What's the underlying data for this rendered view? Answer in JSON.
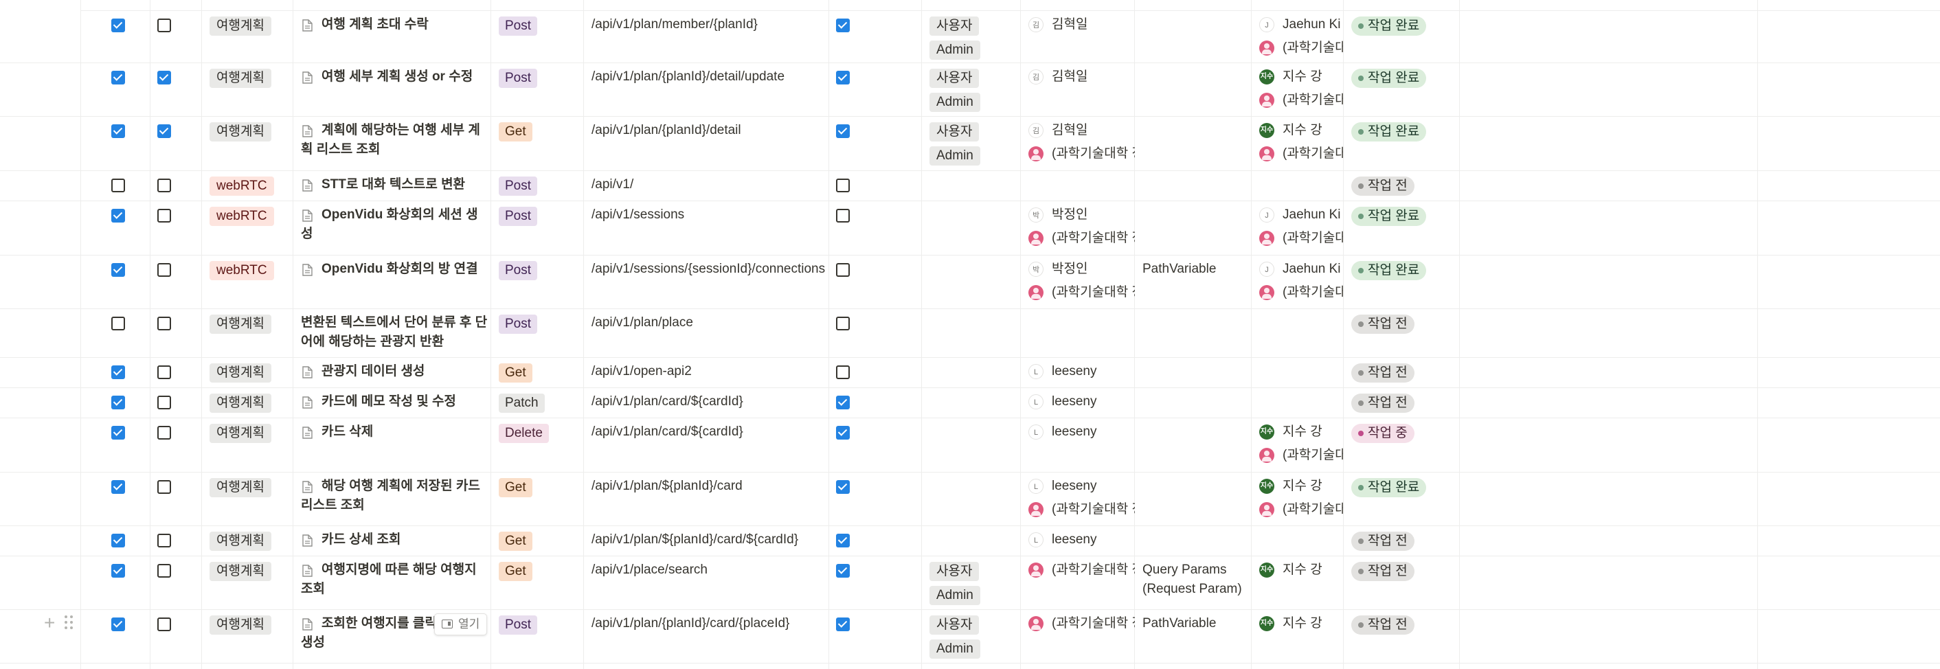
{
  "columns": {
    "tag_options": {
      "travel": "여행계획",
      "webrtc": "webRTC"
    },
    "permission_options": [
      "사용자",
      "Admin"
    ]
  },
  "hover_controls": {
    "add_icon": "plus-icon",
    "drag_icon": "drag-handle-icon",
    "open_label": "열기"
  },
  "rows": [
    {
      "done": true,
      "front": false,
      "tag": "여행계획",
      "tag_style": "travel",
      "has_icon": true,
      "title": "여행 계획 초대 수락",
      "method": "Post",
      "url": "/api/v1/plan/member/{planId}",
      "api_done": true,
      "perms": [
        "사용자",
        "Admin"
      ],
      "backend": [
        {
          "avatar": "init",
          "initial": "김",
          "name": "김혁일"
        }
      ],
      "note": "",
      "frontend": [
        {
          "avatar": "init",
          "initial": "J",
          "name": "Jaehun Ki"
        },
        {
          "avatar": "pink",
          "initial": "",
          "name": "(과학기술대"
        }
      ],
      "status": "작업 완료",
      "status_style": "done"
    },
    {
      "done": true,
      "front": true,
      "tag": "여행계획",
      "tag_style": "travel",
      "has_icon": true,
      "title": "여행 세부 계획 생성 or 수정",
      "method": "Post",
      "url": "/api/v1/plan/{planId}/detail/update",
      "api_done": true,
      "perms": [
        "사용자",
        "Admin"
      ],
      "backend": [
        {
          "avatar": "init",
          "initial": "김",
          "name": "김혁일"
        }
      ],
      "note": "",
      "frontend": [
        {
          "avatar": "green",
          "initial": "지수",
          "name": "지수 강"
        },
        {
          "avatar": "pink",
          "initial": "",
          "name": "(과학기술대"
        }
      ],
      "status": "작업 완료",
      "status_style": "done"
    },
    {
      "done": true,
      "front": true,
      "tag": "여행계획",
      "tag_style": "travel",
      "has_icon": true,
      "title": "계획에 해당하는 여행 세부 계획 리스트 조회",
      "method": "Get",
      "url": "/api/v1/plan/{planId}/detail",
      "api_done": true,
      "perms": [
        "사용자",
        "Admin"
      ],
      "backend": [
        {
          "avatar": "init",
          "initial": "김",
          "name": "김혁일"
        },
        {
          "avatar": "pink",
          "initial": "",
          "name": "(과학기술대학 정"
        }
      ],
      "note": "",
      "frontend": [
        {
          "avatar": "green",
          "initial": "지수",
          "name": "지수 강"
        },
        {
          "avatar": "pink",
          "initial": "",
          "name": "(과학기술대"
        }
      ],
      "status": "작업 완료",
      "status_style": "done"
    },
    {
      "done": false,
      "front": false,
      "tag": "webRTC",
      "tag_style": "webrtc",
      "has_icon": true,
      "title": "STT로 대화 텍스트로 변환",
      "method": "Post",
      "url": "/api/v1/",
      "api_done": false,
      "perms": [],
      "backend": [],
      "note": "",
      "frontend": [],
      "status": "작업 전",
      "status_style": "todo"
    },
    {
      "done": true,
      "front": false,
      "tag": "webRTC",
      "tag_style": "webrtc",
      "has_icon": true,
      "title": "OpenVidu 화상회의 세션 생성",
      "method": "Post",
      "url": "/api/v1/sessions",
      "api_done": false,
      "perms": [],
      "backend": [
        {
          "avatar": "init",
          "initial": "박",
          "name": "박정인"
        },
        {
          "avatar": "pink",
          "initial": "",
          "name": "(과학기술대학 정"
        }
      ],
      "note": "",
      "frontend": [
        {
          "avatar": "init",
          "initial": "J",
          "name": "Jaehun Ki"
        },
        {
          "avatar": "pink",
          "initial": "",
          "name": "(과학기술대"
        }
      ],
      "status": "작업 완료",
      "status_style": "done"
    },
    {
      "done": true,
      "front": false,
      "tag": "webRTC",
      "tag_style": "webrtc",
      "has_icon": true,
      "title": "OpenVidu 화상회의 방 연결",
      "method": "Post",
      "url": "/api/v1/sessions/{sessionId}/connections",
      "api_done": false,
      "perms": [],
      "backend": [
        {
          "avatar": "init",
          "initial": "박",
          "name": "박정인"
        },
        {
          "avatar": "pink",
          "initial": "",
          "name": "(과학기술대학 정"
        }
      ],
      "note": "PathVariable",
      "frontend": [
        {
          "avatar": "init",
          "initial": "J",
          "name": "Jaehun Ki"
        },
        {
          "avatar": "pink",
          "initial": "",
          "name": "(과학기술대"
        }
      ],
      "status": "작업 완료",
      "status_style": "done"
    },
    {
      "done": false,
      "front": false,
      "tag": "여행계획",
      "tag_style": "travel",
      "has_icon": false,
      "title": "변환된 텍스트에서 단어 분류 후 단어에 해당하는 관광지 반환",
      "method": "Post",
      "url": "/api/v1/plan/place",
      "api_done": false,
      "perms": [],
      "backend": [],
      "note": "",
      "frontend": [],
      "status": "작업 전",
      "status_style": "todo"
    },
    {
      "done": true,
      "front": false,
      "tag": "여행계획",
      "tag_style": "travel",
      "has_icon": true,
      "title": "관광지 데이터 생성",
      "method": "Get",
      "url": "/api/v1/open-api2",
      "api_done": false,
      "perms": [],
      "backend": [
        {
          "avatar": "init",
          "initial": "L",
          "name": "leeseny"
        }
      ],
      "note": "",
      "frontend": [],
      "status": "작업 전",
      "status_style": "todo"
    },
    {
      "done": true,
      "front": false,
      "tag": "여행계획",
      "tag_style": "travel",
      "has_icon": true,
      "title": "카드에 메모 작성 및 수정",
      "method": "Patch",
      "url": "/api/v1/plan/card/${cardId}",
      "api_done": true,
      "perms": [],
      "backend": [
        {
          "avatar": "init",
          "initial": "L",
          "name": "leeseny"
        }
      ],
      "note": "",
      "frontend": [],
      "status": "작업 전",
      "status_style": "todo"
    },
    {
      "done": true,
      "front": false,
      "tag": "여행계획",
      "tag_style": "travel",
      "has_icon": true,
      "title": "카드 삭제",
      "method": "Delete",
      "url": "/api/v1/plan/card/${cardId}",
      "api_done": true,
      "perms": [],
      "backend": [
        {
          "avatar": "init",
          "initial": "L",
          "name": "leeseny"
        }
      ],
      "note": "",
      "frontend": [
        {
          "avatar": "green",
          "initial": "지수",
          "name": "지수 강"
        },
        {
          "avatar": "pink",
          "initial": "",
          "name": "(과학기술대"
        }
      ],
      "status": "작업 중",
      "status_style": "prog"
    },
    {
      "done": true,
      "front": false,
      "tag": "여행계획",
      "tag_style": "travel",
      "has_icon": true,
      "title": "해당 여행 계획에 저장된 카드 리스트 조회",
      "method": "Get",
      "url": "/api/v1/plan/${planId}/card",
      "api_done": true,
      "perms": [],
      "backend": [
        {
          "avatar": "init",
          "initial": "L",
          "name": "leeseny"
        },
        {
          "avatar": "pink",
          "initial": "",
          "name": "(과학기술대학 정"
        }
      ],
      "note": "",
      "frontend": [
        {
          "avatar": "green",
          "initial": "지수",
          "name": "지수 강"
        },
        {
          "avatar": "pink",
          "initial": "",
          "name": "(과학기술대"
        }
      ],
      "status": "작업 완료",
      "status_style": "done"
    },
    {
      "done": true,
      "front": false,
      "tag": "여행계획",
      "tag_style": "travel",
      "has_icon": true,
      "title": "카드 상세 조회",
      "method": "Get",
      "url": "/api/v1/plan/${planId}/card/${cardId}",
      "api_done": true,
      "perms": [],
      "backend": [
        {
          "avatar": "init",
          "initial": "L",
          "name": "leeseny"
        }
      ],
      "note": "",
      "frontend": [],
      "status": "작업 전",
      "status_style": "todo"
    },
    {
      "done": true,
      "front": false,
      "tag": "여행계획",
      "tag_style": "travel",
      "has_icon": true,
      "title": "여행지명에 따른 해당 여행지 조회",
      "method": "Get",
      "url": "/api/v1/place/search",
      "api_done": true,
      "perms": [
        "사용자",
        "Admin"
      ],
      "backend": [
        {
          "avatar": "pink",
          "initial": "",
          "name": "(과학기술대학 정"
        }
      ],
      "note": "Query Params (Request Param)",
      "frontend": [
        {
          "avatar": "green",
          "initial": "지수",
          "name": "지수 강"
        }
      ],
      "status": "작업 전",
      "status_style": "todo"
    },
    {
      "done": true,
      "front": false,
      "tag": "여행계획",
      "tag_style": "travel",
      "has_icon": true,
      "title": "조회한 여행지를 클릭 시 카드 생성",
      "method": "Post",
      "url": "/api/v1/plan/{planId}/card/{placeId}",
      "api_done": true,
      "perms": [
        "사용자",
        "Admin"
      ],
      "backend": [
        {
          "avatar": "pink",
          "initial": "",
          "name": "(과학기술대학 정"
        }
      ],
      "note": "PathVariable",
      "frontend": [
        {
          "avatar": "green",
          "initial": "지수",
          "name": "지수 강"
        }
      ],
      "status": "작업 전",
      "status_style": "todo"
    }
  ]
}
